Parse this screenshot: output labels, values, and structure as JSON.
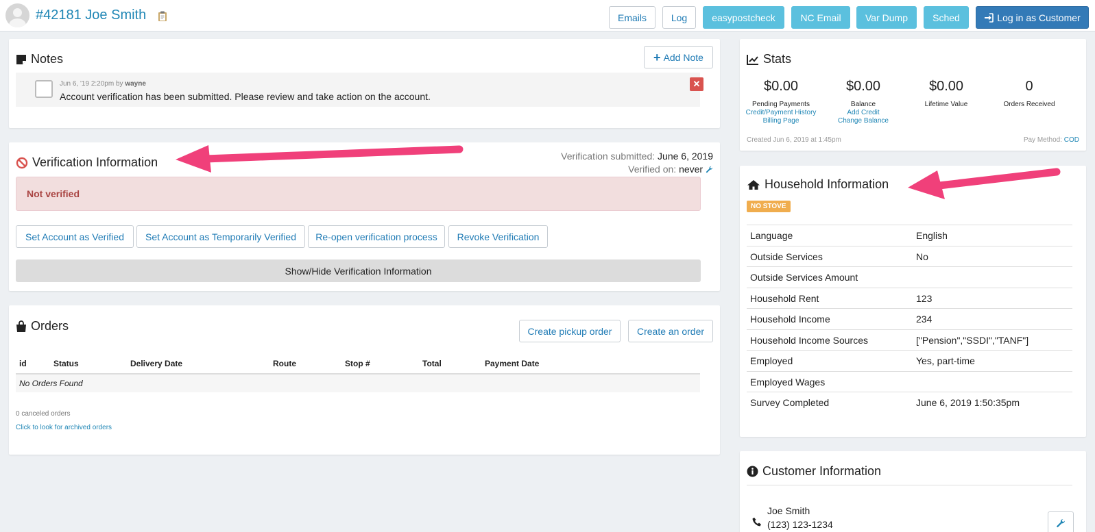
{
  "header": {
    "customer_title": "#42181 Joe Smith",
    "buttons": {
      "emails": "Emails",
      "log": "Log",
      "easypostcheck": "easypostcheck",
      "nc_email": "NC Email",
      "var_dump": "Var Dump",
      "sched": "Sched",
      "login_as_customer": "Log in as Customer"
    }
  },
  "notes": {
    "title": "Notes",
    "add_note": "Add Note",
    "items": [
      {
        "date": "Jun 6, '19 2:20pm by",
        "author": "wayne",
        "text": "Account verification has been submitted. Please review and take action on the account."
      }
    ]
  },
  "verification": {
    "title": "Verification Information",
    "submitted_label": "Verification submitted:",
    "submitted_value": "June 6, 2019",
    "verified_label": "Verified on:",
    "verified_value": "never",
    "status": "Not verified",
    "actions": {
      "set_verified": "Set Account as Verified",
      "set_temp_verified": "Set Account as Temporarily Verified",
      "reopen": "Re-open verification process",
      "revoke": "Revoke Verification"
    },
    "toggle": "Show/Hide Verification Information"
  },
  "orders": {
    "title": "Orders",
    "create_pickup": "Create pickup order",
    "create_order": "Create an order",
    "columns": [
      "id",
      "Status",
      "Delivery Date",
      "Route",
      "Stop #",
      "Total",
      "Payment Date"
    ],
    "empty": "No Orders Found",
    "canceled": "0 canceled orders",
    "archived_link": "Click to look for archived orders"
  },
  "stats": {
    "title": "Stats",
    "items": [
      {
        "value": "$0.00",
        "label": "Pending Payments",
        "links": [
          "Credit/Payment History",
          "Billing Page"
        ]
      },
      {
        "value": "$0.00",
        "label": "Balance",
        "links": [
          "Add Credit",
          "Change Balance"
        ]
      },
      {
        "value": "$0.00",
        "label": "Lifetime Value",
        "links": []
      },
      {
        "value": "0",
        "label": "Orders Received",
        "links": []
      }
    ],
    "created": "Created Jun 6, 2019 at 1:45pm",
    "pay_method_label": "Pay Method:",
    "pay_method_value": "COD"
  },
  "household": {
    "title": "Household Information",
    "badge": "NO STOVE",
    "rows": [
      {
        "key": "Language",
        "value": "English"
      },
      {
        "key": "Outside Services",
        "value": "No"
      },
      {
        "key": "Outside Services Amount",
        "value": ""
      },
      {
        "key": "Household Rent",
        "value": "123"
      },
      {
        "key": "Household Income",
        "value": "234"
      },
      {
        "key": "Household Income Sources",
        "value": "[\"Pension\",\"SSDI\",\"TANF\"]"
      },
      {
        "key": "Employed",
        "value": "Yes, part-time"
      },
      {
        "key": "Employed Wages",
        "value": ""
      },
      {
        "key": "Survey Completed",
        "value": "June 6, 2019 1:50:35pm"
      }
    ]
  },
  "customer": {
    "title": "Customer Information",
    "name": "Joe Smith",
    "phone": "(123) 123-1234"
  },
  "colors": {
    "link": "#1f86b5",
    "info": "#5bc0de",
    "primary": "#337ab7",
    "danger": "#d9534f",
    "warning": "#f0ad4e",
    "annotation_arrow": "#f0407a"
  }
}
